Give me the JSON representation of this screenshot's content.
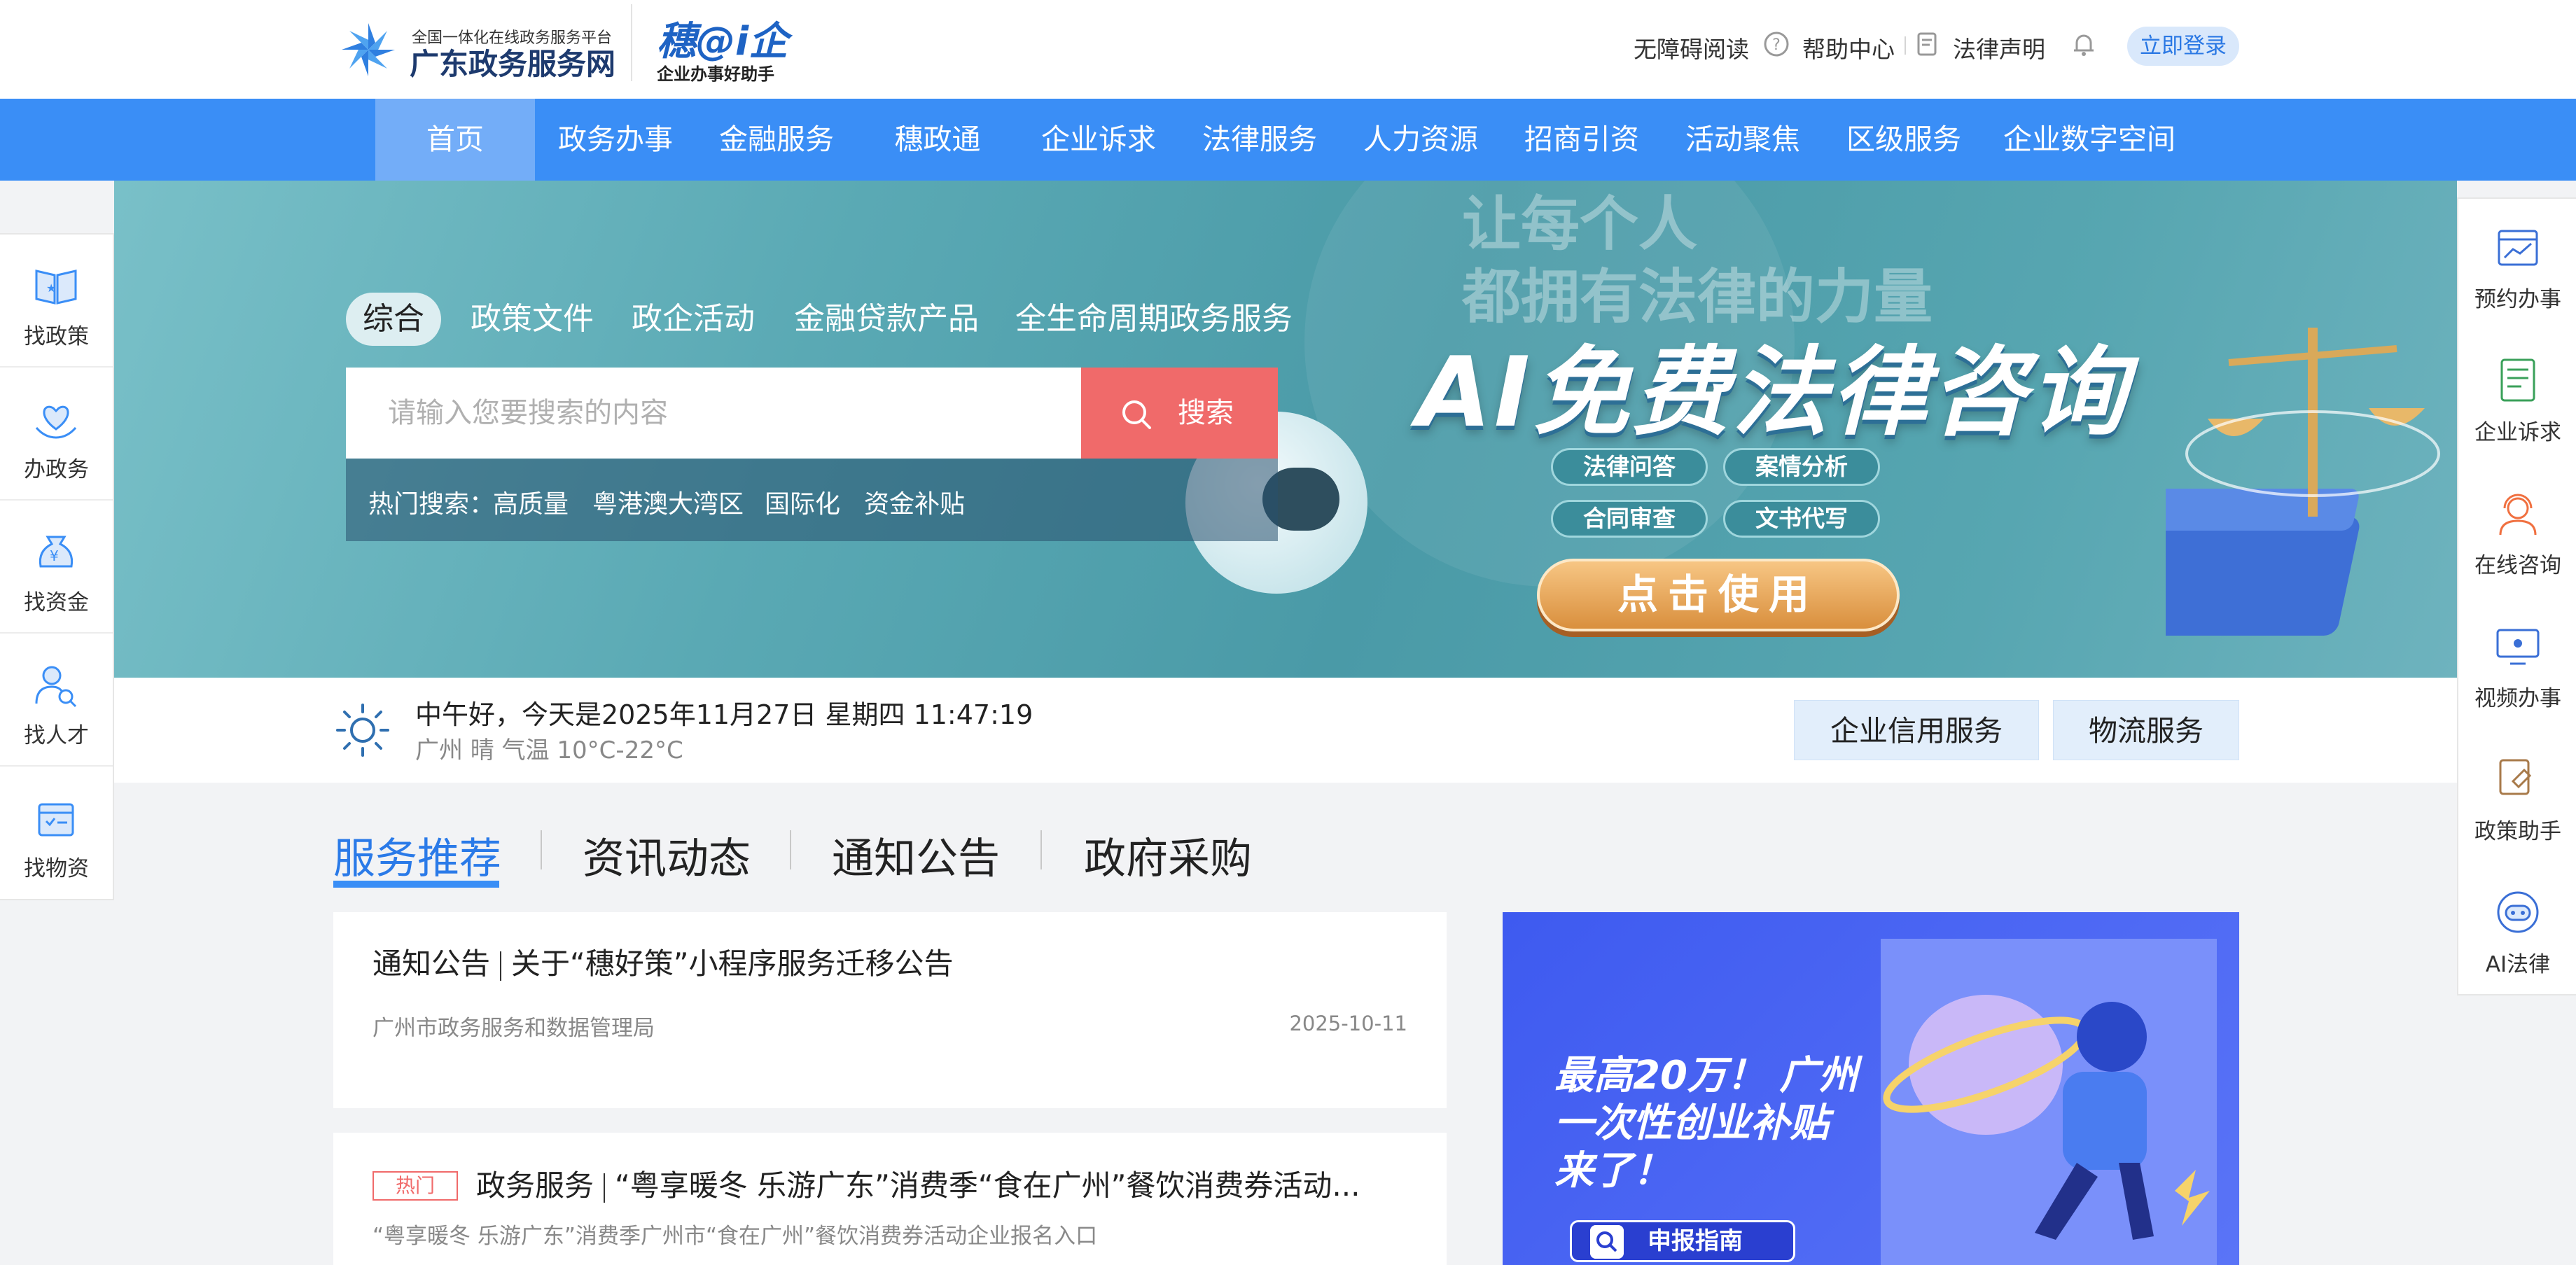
{
  "header": {
    "logo_line1": "全国一体化在线政务服务平台",
    "logo_line2": "广东政务服务网",
    "logo2_title": "穗@i企",
    "logo2_sub": "企业办事好助手",
    "links": [
      "无障碍阅读",
      "帮助中心",
      "法律声明"
    ],
    "login_label": "立即登录"
  },
  "nav": {
    "items": [
      "首页",
      "政务办事",
      "金融服务",
      "穗政通",
      "企业诉求",
      "法律服务",
      "人力资源",
      "招商引资",
      "活动聚焦",
      "区级服务",
      "企业数字空间"
    ],
    "active_index": 0
  },
  "banner": {
    "slogan_line1": "让每个人",
    "slogan_line2": "都拥有法律的力量",
    "title": "AI免费法律咨询",
    "pills": [
      "法律问答",
      "案情分析",
      "合同审查",
      "文书代写"
    ],
    "cta": "点击使用",
    "slide_count": 5,
    "active_slide": 1
  },
  "search": {
    "tabs": [
      "综合",
      "政策文件",
      "政企活动",
      "金融贷款产品",
      "全生命周期政务服务"
    ],
    "active_tab": 0,
    "placeholder": "请输入您要搜索的内容",
    "button_label": "搜索",
    "hot_label": "热门搜索：",
    "hot_items": [
      "高质量",
      "粤港澳大湾区",
      "国际化",
      "资金补贴"
    ]
  },
  "info": {
    "greeting": "中午好，今天是2025年11月27日 星期四 11:47:19",
    "weather": "广州  晴  气温  10°C-22°C",
    "services": [
      "企业信用服务",
      "物流服务"
    ]
  },
  "side_left": {
    "items": [
      {
        "label": "找政策",
        "icon": "policy-book-icon"
      },
      {
        "label": "办政务",
        "icon": "heart-hands-icon"
      },
      {
        "label": "找资金",
        "icon": "money-bag-icon"
      },
      {
        "label": "找人才",
        "icon": "person-search-icon"
      },
      {
        "label": "找物资",
        "icon": "supplies-box-icon"
      }
    ]
  },
  "side_right": {
    "items": [
      {
        "label": "预约办事",
        "icon": "calendar-chart-icon"
      },
      {
        "label": "企业诉求",
        "icon": "document-icon"
      },
      {
        "label": "在线咨询",
        "icon": "headset-agent-icon"
      },
      {
        "label": "视频办事",
        "icon": "video-monitor-icon"
      },
      {
        "label": "政策助手",
        "icon": "policy-assistant-icon"
      },
      {
        "label": "AI法律",
        "icon": "robot-icon"
      }
    ]
  },
  "content": {
    "tabs": [
      "服务推荐",
      "资讯动态",
      "通知公告",
      "政府采购"
    ],
    "active_tab": 0,
    "cards": [
      {
        "category": "通知公告",
        "title": "关于“穗好策”小程序服务迁移公告",
        "source": "广州市政务服务和数据管理局",
        "date": "2025-10-11"
      },
      {
        "tag": "热门",
        "category": "政务服务",
        "title": "“粤享暖冬 乐游广东”消费季“食在广州”餐饮消费券活动...",
        "summary": "“粤享暖冬 乐游广东”消费季广州市“食在广州”餐饮消费券活动企业报名入口"
      }
    ]
  },
  "ad": {
    "text_line1": "最高20万！ 广州",
    "text_line2": "一次性创业补贴",
    "text_line3": "来了！",
    "button": "申报指南"
  },
  "colors": {
    "brand_blue": "#3a8ef6",
    "nav_active": "#73adf8",
    "search_red": "#f06a6a",
    "accent_text": "#2a7ae8"
  }
}
